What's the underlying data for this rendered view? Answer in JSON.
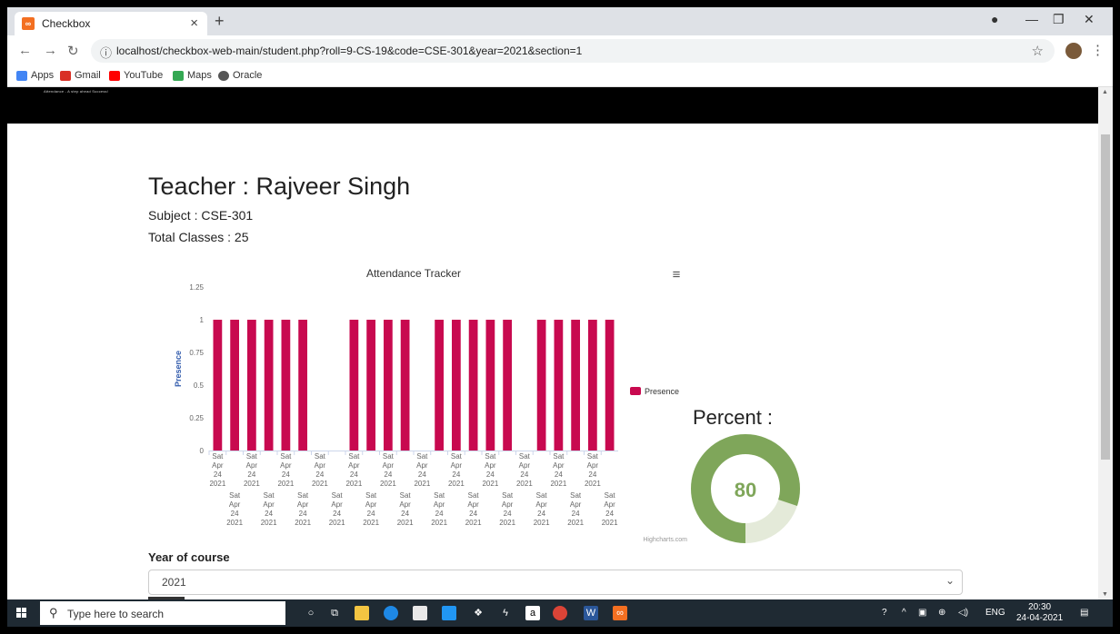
{
  "browser": {
    "tab_title": "Checkbox",
    "url": "localhost/checkbox-web-main/student.php?roll=9-CS-19&code=CSE-301&year=2021&section=1",
    "bookmarks": [
      "Apps",
      "Gmail",
      "YouTube",
      "Maps",
      "Oracle"
    ]
  },
  "hero": {
    "tagline": "Attendance - A step ahead Success!"
  },
  "teacher": {
    "heading": "Teacher : Rajveer Singh",
    "subject": "Subject : CSE-301",
    "total": "Total Classes : 25"
  },
  "chart_data": {
    "type": "bar",
    "title": "Attendance Tracker",
    "ylabel": "Presence",
    "ylim": [
      0,
      1.25
    ],
    "yticks": [
      "0",
      "0.25",
      "0.5",
      "0.75",
      "1",
      "1.25"
    ],
    "category_label": [
      "Sat",
      "Apr",
      "24",
      "2021"
    ],
    "series": [
      {
        "name": "Presence",
        "values": [
          1,
          1,
          1,
          1,
          1,
          1,
          0,
          0,
          1,
          1,
          1,
          1,
          0,
          1,
          1,
          1,
          1,
          1,
          0,
          1,
          1,
          1,
          1,
          1
        ]
      }
    ],
    "credit": "Highcharts.com",
    "color": "#c8094f"
  },
  "percent": {
    "label": "Percent :",
    "value": 80,
    "display": "80"
  },
  "form": {
    "year_label": "Year of course",
    "year_value": "2021"
  },
  "taskbar": {
    "search_placeholder": "Type here to search",
    "lang": "ENG",
    "time": "20:30",
    "date": "24-04-2021"
  }
}
